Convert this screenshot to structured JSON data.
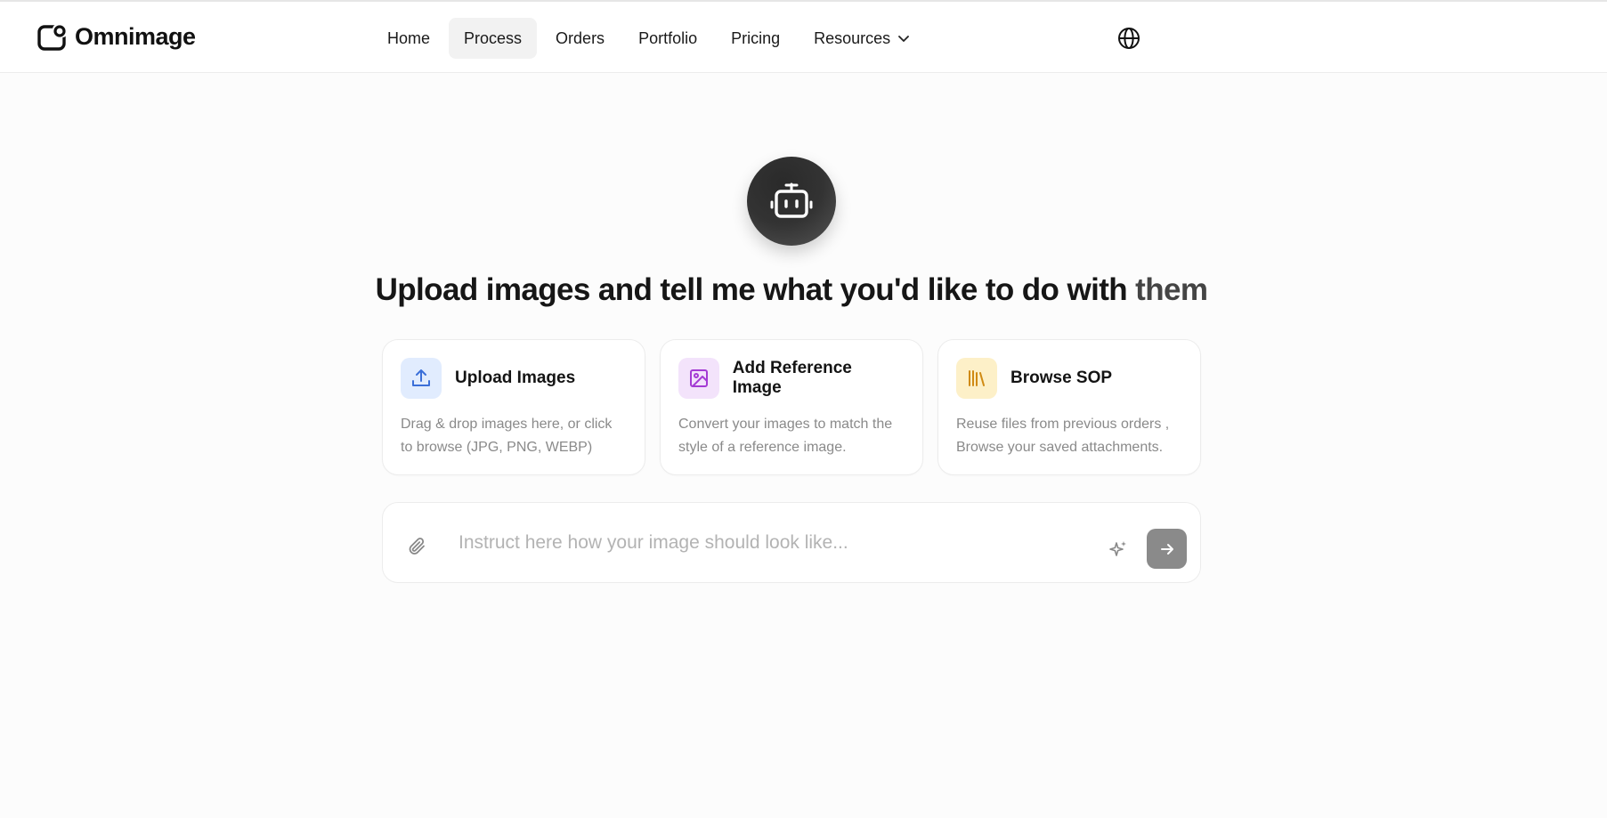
{
  "brand": {
    "name": "Omnimage",
    "icon": "logo-mark-icon"
  },
  "nav": {
    "items": [
      {
        "label": "Home"
      },
      {
        "label": "Process",
        "active": true
      },
      {
        "label": "Orders"
      },
      {
        "label": "Portfolio"
      },
      {
        "label": "Pricing"
      },
      {
        "label": "Resources",
        "has_dropdown": true
      }
    ],
    "language_icon": "globe-icon"
  },
  "hero": {
    "icon": "robot-icon",
    "headline_strong": "Upload images and tell me what you'd like to do with",
    "headline_fade": " them"
  },
  "cards": [
    {
      "title": "Upload Images",
      "description": "Drag & drop images here, or click to browse (JPG, PNG, WEBP)",
      "icon": "upload-icon",
      "icon_bg": "#e1ecfe",
      "icon_color": "#3b6fd8"
    },
    {
      "title": "Add Reference Image",
      "description": "Convert your images to match the style of a reference image.",
      "icon": "image-icon",
      "icon_bg": "#f3e3fb",
      "icon_color": "#a43bd4"
    },
    {
      "title": "Browse SOP",
      "description": "Reuse files from previous orders , Browse your saved attachments.",
      "icon": "library-icon",
      "icon_bg": "#fdf0c8",
      "icon_color": "#d08a13"
    }
  ],
  "composer": {
    "placeholder": "Instruct here how your image should look like...",
    "value": "",
    "attach_icon": "paperclip-icon",
    "enhance_icon": "sparkle-icon",
    "send_icon": "arrow-right-icon",
    "send_bg": "#8a8a8a"
  }
}
